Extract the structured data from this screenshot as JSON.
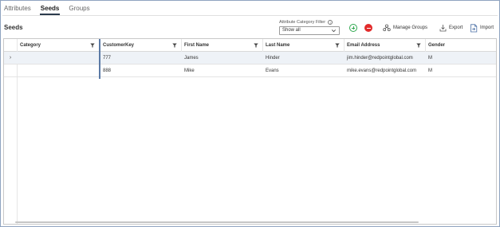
{
  "tabs": [
    {
      "label": "Attributes"
    },
    {
      "label": "Seeds"
    },
    {
      "label": "Groups"
    }
  ],
  "page_title": "Seeds",
  "filter": {
    "label": "Attribute Category Filter",
    "selected": "Show all"
  },
  "toolbar": {
    "add_icon": "add-circle-icon",
    "remove_icon": "remove-circle-icon",
    "manage_groups": "Manage Groups",
    "export": "Export",
    "import": "Import"
  },
  "columns": [
    "Category",
    "CustomerKey",
    "First Name",
    "Last Name",
    "Email Address",
    "Gender"
  ],
  "rows": [
    {
      "category": "",
      "customer_key": "777",
      "first_name": "James",
      "last_name": "Hinder",
      "email": "jim.hinder@redpointglobal.com",
      "gender": "M"
    },
    {
      "category": "",
      "customer_key": "888",
      "first_name": "Mike",
      "last_name": "Evans",
      "email": "mike.evans@redpointglobal.com",
      "gender": "M"
    }
  ],
  "colors": {
    "accent_tab": "#2b3a4c",
    "add": "#2fa84f",
    "remove": "#e22b2b",
    "selected_row": "#eef2f7"
  }
}
